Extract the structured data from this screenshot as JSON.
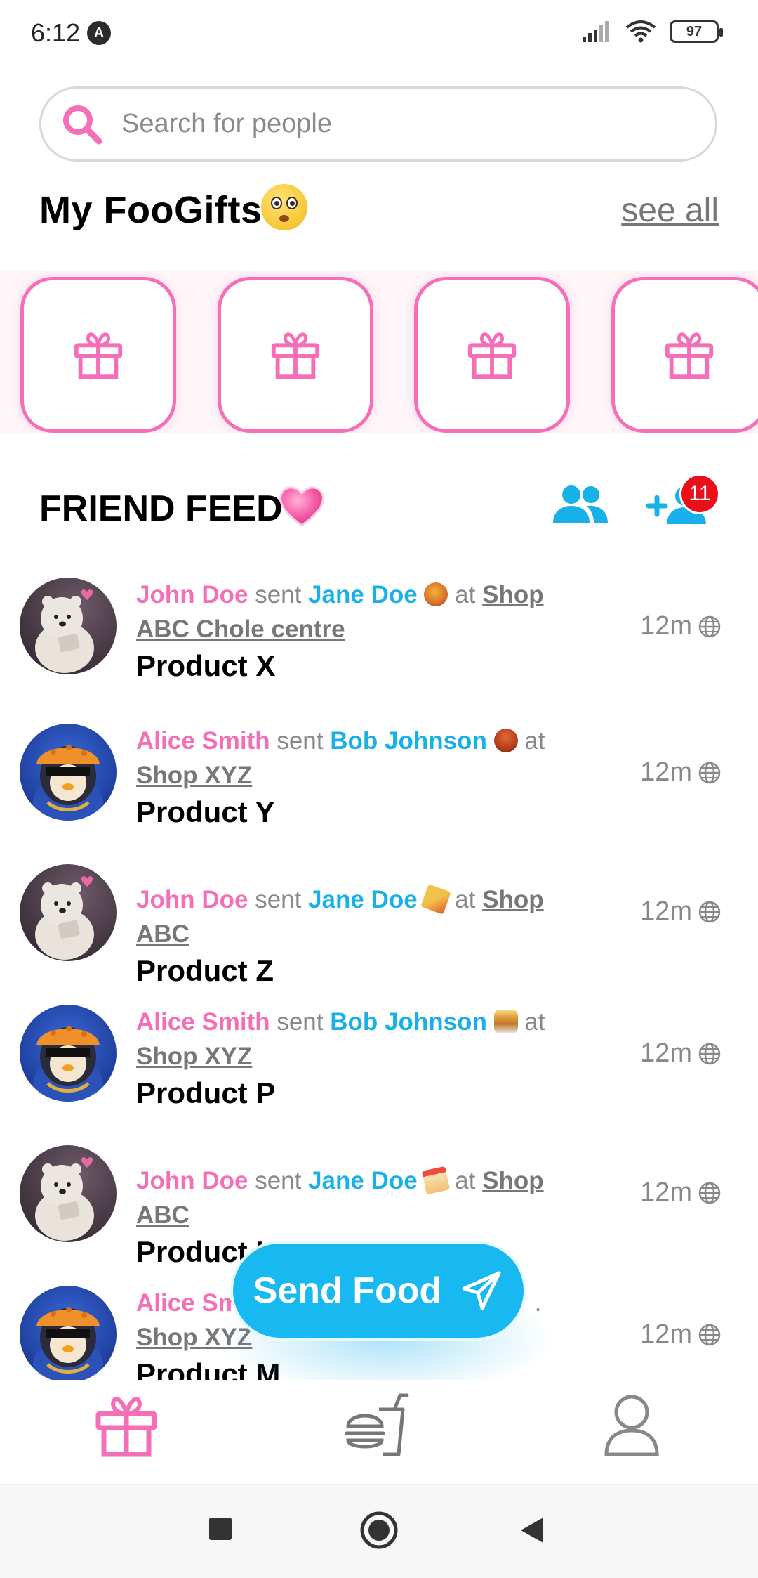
{
  "status_bar": {
    "time": "6:12",
    "notif_icon": "A",
    "battery": "97"
  },
  "search": {
    "placeholder": "Search for people"
  },
  "gifts": {
    "title": "My FooGifts",
    "see_all": "see all",
    "card_count": 4
  },
  "feed": {
    "title": "FRIEND FEED",
    "friend_requests_badge": "11",
    "items": [
      {
        "sender": "John Doe",
        "verb": "sent",
        "receiver": "Jane Doe",
        "at": "at",
        "shop": "Shop ABC Chole centre",
        "product": "Product X",
        "time": "12m",
        "avatar": "bear-avatar",
        "emoji": "paella-emoji"
      },
      {
        "sender": "Alice Smith",
        "verb": "sent",
        "receiver": "Bob Johnson",
        "at": "at",
        "shop": "Shop XYZ",
        "product": "Product Y",
        "time": "12m",
        "avatar": "penguin-avatar",
        "emoji": "stew-emoji"
      },
      {
        "sender": "John Doe",
        "verb": "sent",
        "receiver": "Jane Doe",
        "at": "at",
        "shop": "Shop ABC",
        "product": "Product Z",
        "time": "12m",
        "avatar": "bear-avatar",
        "emoji": "pizza-emoji"
      },
      {
        "sender": "Alice Smith",
        "verb": "sent",
        "receiver": "Bob Johnson",
        "at": "at",
        "shop": "Shop XYZ",
        "product": "Product P",
        "time": "12m",
        "avatar": "penguin-avatar",
        "emoji": "pancakes-emoji"
      },
      {
        "sender": "John Doe",
        "verb": "sent",
        "receiver": "Jane Doe",
        "at": "at",
        "shop": "Shop ABC",
        "product": "Product K",
        "time": "12m",
        "avatar": "bear-avatar",
        "emoji": "cake-emoji"
      },
      {
        "sender": "Alice Sm",
        "verb": "",
        "receiver": "",
        "at": ".",
        "shop": "Shop XYZ",
        "product": "Product M",
        "time": "12m",
        "avatar": "penguin-avatar",
        "emoji": ""
      }
    ]
  },
  "fab": {
    "label": "Send Food"
  },
  "colors": {
    "pink": "#f56fb8",
    "blue": "#18b0e8",
    "badge_red": "#e8101a"
  }
}
